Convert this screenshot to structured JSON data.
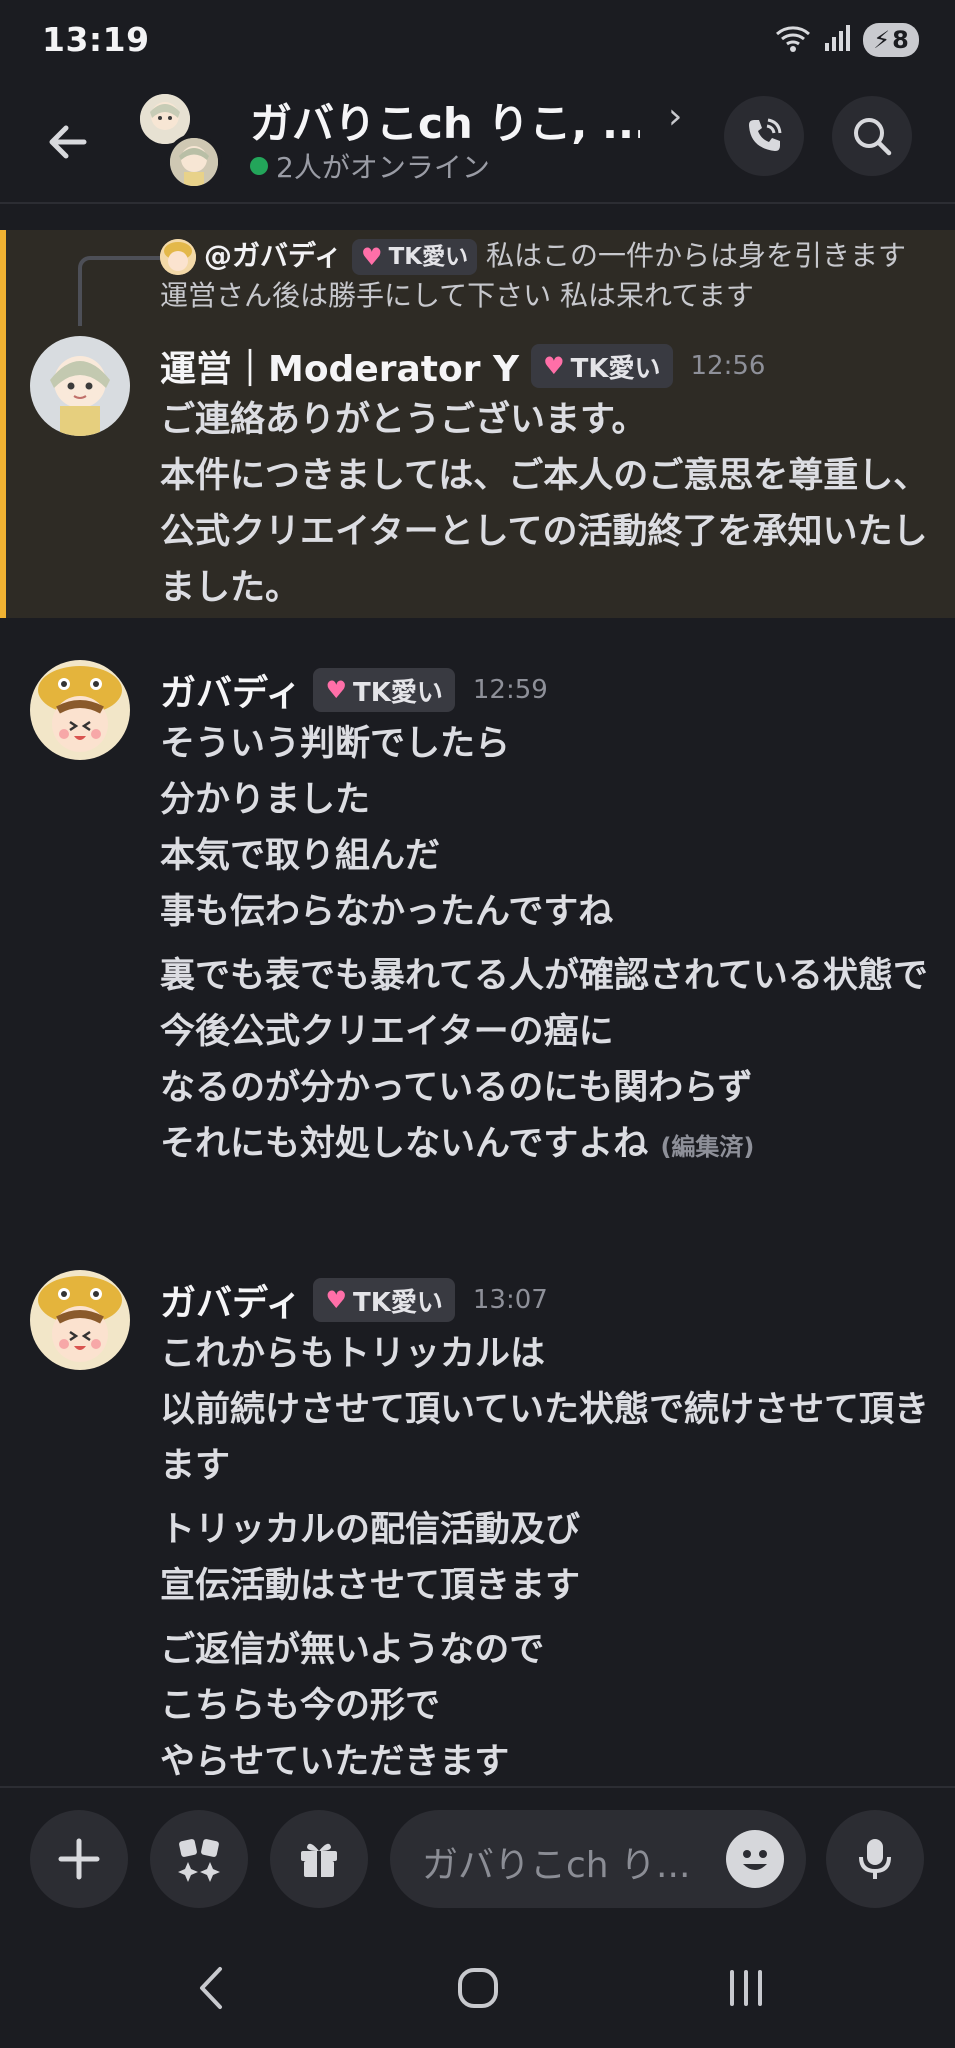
{
  "status_bar": {
    "time": "13:19",
    "battery": "8"
  },
  "header": {
    "title": "ガバりこch りこ, ...",
    "online": "2人がオンライン"
  },
  "reply": {
    "author": "@ガバディ",
    "tag": "TK愛い",
    "text": "私はこの一件からは身を引きます 運営さん後は勝手にして下さい 私は呆れてます"
  },
  "messages": [
    {
      "author": "運営｜Moderator Y",
      "tag": "TK愛い",
      "time": "12:56",
      "lines": [
        "ご連絡ありがとうございます。",
        "本件につきましては、ご本人のご意思を尊重し、公式クリエイターとしての活動終了を承知いたしました。"
      ]
    },
    {
      "author": "ガバディ",
      "tag": "TK愛い",
      "time": "12:59",
      "lines": [
        "そういう判断でしたら",
        "分かりました",
        "本気で取り組んだ",
        "事も伝わらなかったんですね",
        "裏でも表でも暴れてる人が確認されている状態で",
        "今後公式クリエイターの癌に",
        "なるのが分かっているのにも関わらず",
        "それにも対処しないんですよね"
      ],
      "edited": "(編集済)"
    },
    {
      "author": "ガバディ",
      "tag": "TK愛い",
      "time": "13:07",
      "lines": [
        "これからもトリッカルは",
        "以前続けさせて頂いていた状態で続けさせて頂きます",
        "トリッカルの配信活動及び",
        "宣伝活動はさせて頂きます",
        "ご返信が無いようなので",
        "こちらも今の形で",
        "やらせていただきます"
      ]
    }
  ],
  "input": {
    "placeholder": "ガバりこch り..."
  },
  "icons": {
    "back": "arrow-left-icon",
    "call": "phone-call-icon",
    "search": "search-icon",
    "plus": "plus-icon",
    "apps": "apps-sparkle-icon",
    "gift": "gift-icon",
    "emoji": "emoji-icon",
    "mic": "microphone-icon"
  },
  "colors": {
    "background": "#1b1c21",
    "highlight": "#2e2b25",
    "highlight_bar": "#f0b232",
    "online": "#23a55a",
    "heart": "#ff6fa8"
  }
}
